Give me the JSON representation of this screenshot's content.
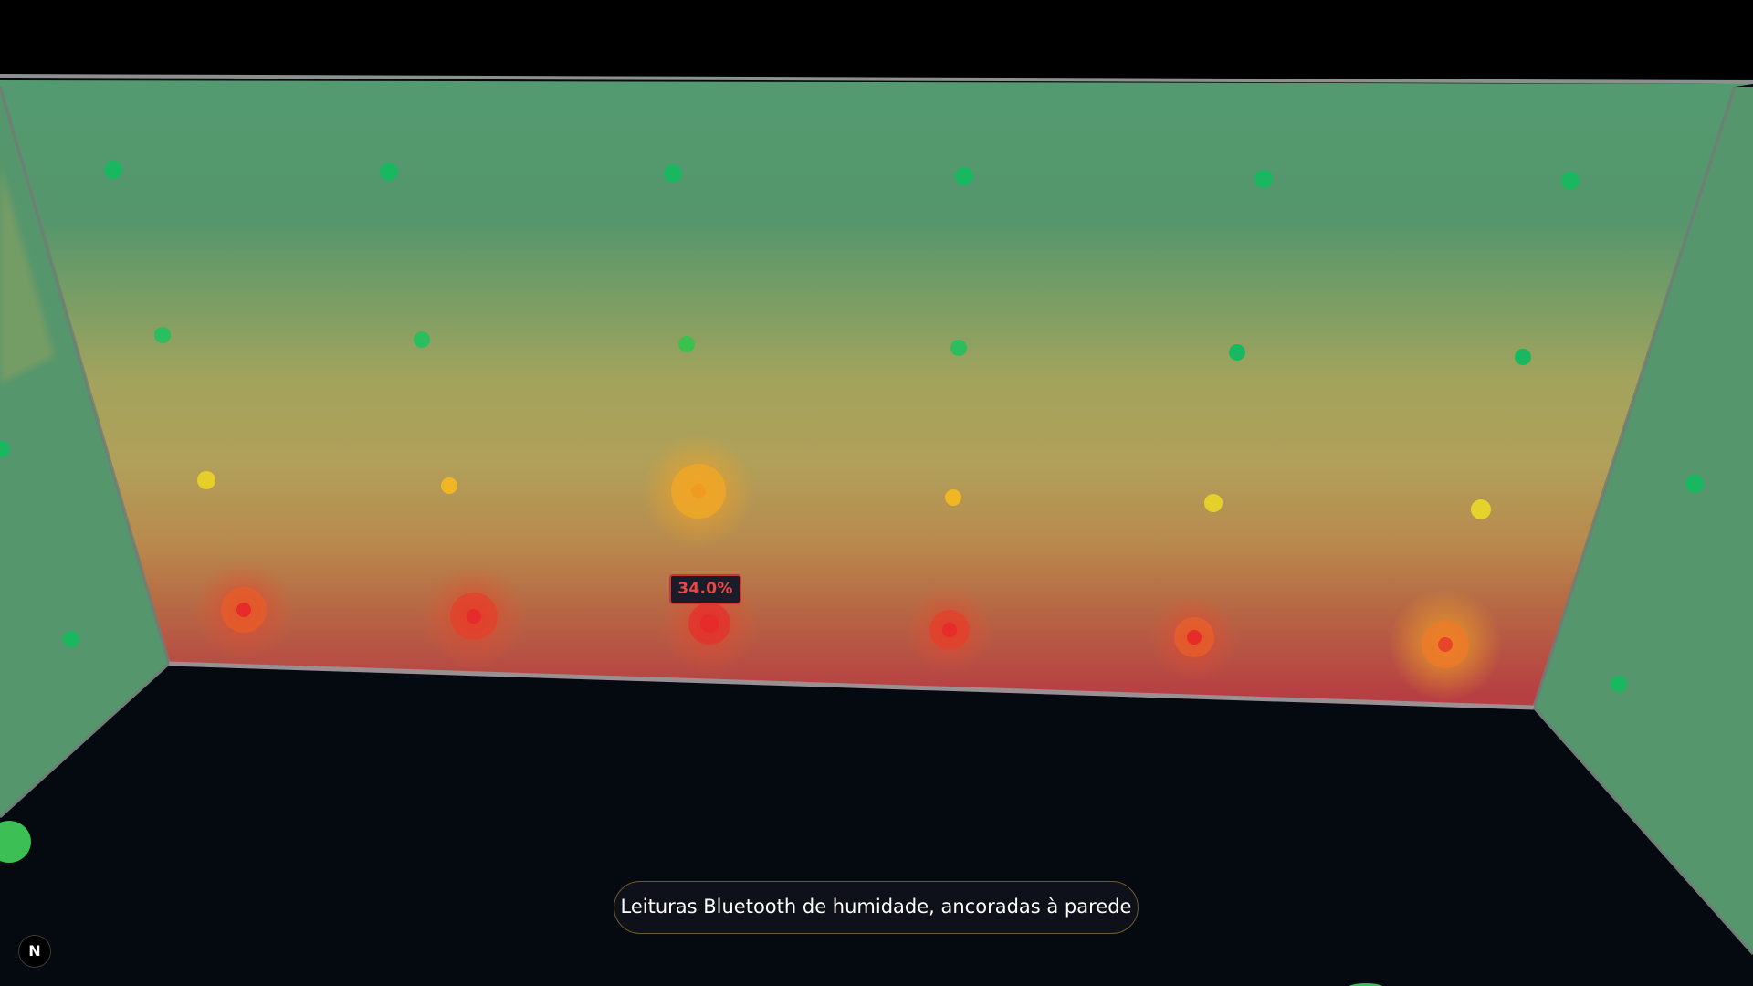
{
  "tooltip": {
    "value": "34.0%"
  },
  "caption": {
    "text": "Leituras Bluetooth de humidade, ancoradas à parede"
  },
  "badge": {
    "letter": "N"
  },
  "colors": {
    "low_humidity": "#55966c",
    "mid_humidity": "#a2a35d",
    "high_humidity": "#b73f43",
    "sensor_green": "#19b860",
    "sensor_yellow": "#e6cf2a",
    "sensor_orange": "#f19a21",
    "sensor_red": "#e62b2a",
    "floor": "#050a10"
  },
  "sensors": [
    {
      "row": 1,
      "level": "green"
    },
    {
      "row": 1,
      "level": "green"
    },
    {
      "row": 1,
      "level": "green"
    },
    {
      "row": 1,
      "level": "green"
    },
    {
      "row": 1,
      "level": "green"
    },
    {
      "row": 1,
      "level": "green"
    },
    {
      "row": 2,
      "level": "green"
    },
    {
      "row": 2,
      "level": "green"
    },
    {
      "row": 2,
      "level": "green"
    },
    {
      "row": 2,
      "level": "green"
    },
    {
      "row": 2,
      "level": "green"
    },
    {
      "row": 2,
      "level": "green"
    },
    {
      "row": 3,
      "level": "yellow"
    },
    {
      "row": 3,
      "level": "orange",
      "highlighted": true
    },
    {
      "row": 3,
      "level": "yellow"
    },
    {
      "row": 3,
      "level": "yellow"
    },
    {
      "row": 3,
      "level": "yellow"
    },
    {
      "row": 3,
      "level": "yellow"
    },
    {
      "row": 4,
      "level": "red"
    },
    {
      "row": 4,
      "level": "red"
    },
    {
      "row": 4,
      "level": "red",
      "selected": true
    },
    {
      "row": 4,
      "level": "red"
    },
    {
      "row": 4,
      "level": "red"
    },
    {
      "row": 4,
      "level": "orange"
    }
  ]
}
